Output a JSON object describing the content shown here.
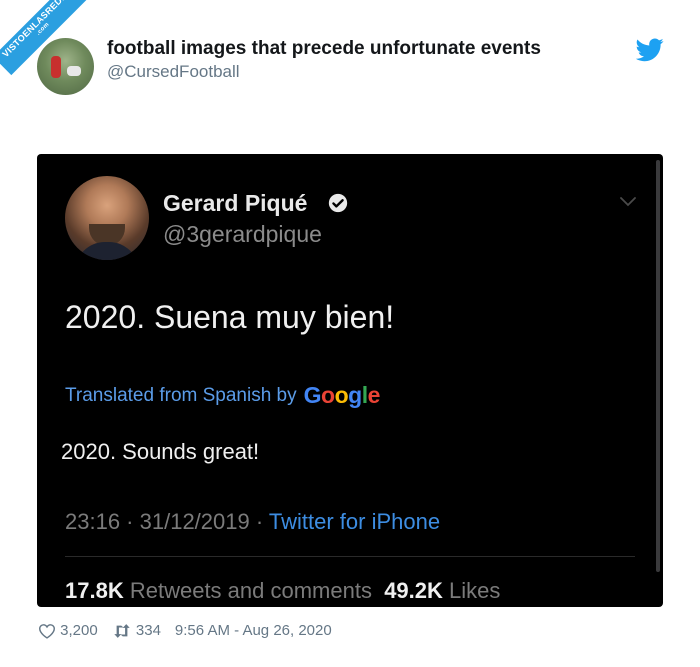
{
  "watermark": {
    "text": "VISTOENLASREDES",
    "sub": ".com"
  },
  "outer": {
    "name": "football images that precede unfortunate events",
    "handle": "@CursedFootball"
  },
  "inner": {
    "name": "Gerard Piqué",
    "handle": "@3gerardpique",
    "text": "2020. Suena muy bien!",
    "translated_label": "Translated from Spanish by",
    "google": [
      "G",
      "o",
      "o",
      "g",
      "l",
      "e"
    ],
    "translation": "2020. Sounds great!",
    "time": "23:16",
    "date": "31/12/2019",
    "separator": " · ",
    "source": "Twitter for iPhone",
    "retweets_count": "17.8K",
    "retweets_label": "Retweets and comments",
    "likes_count": "49.2K",
    "likes_label": "Likes"
  },
  "footer": {
    "likes": "3,200",
    "retweets": "334",
    "timestamp": "9:56 AM - Aug 26, 2020"
  },
  "colors": {
    "twitter_blue": "#1da1f2",
    "link_blue": "#3d8de2",
    "dark_bg": "#000000",
    "gray_text": "#657786"
  },
  "icons": [
    "twitter-bird-icon",
    "verified-badge-icon",
    "chevron-down-icon",
    "heart-icon",
    "retweet-icon"
  ]
}
